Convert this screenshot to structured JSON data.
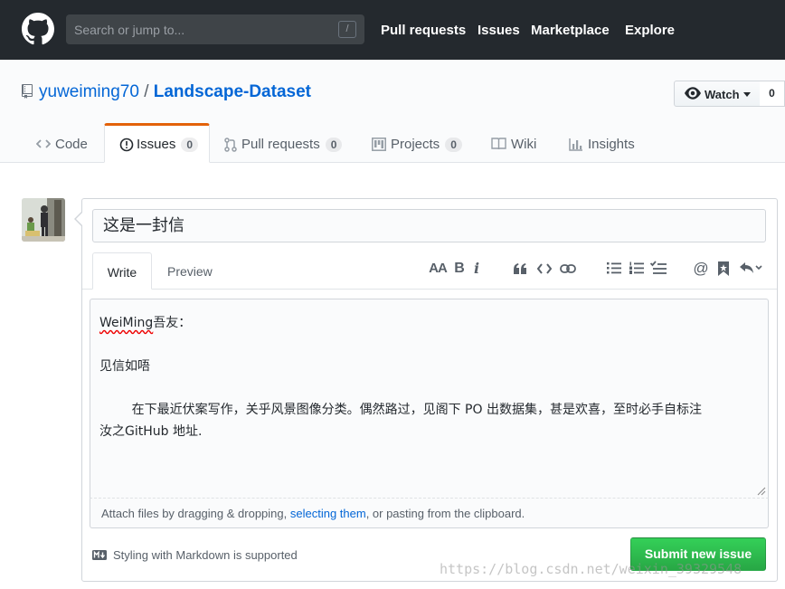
{
  "header": {
    "search_placeholder": "Search or jump to...",
    "search_shortcut": "/",
    "nav": [
      "Pull requests",
      "Issues",
      "Marketplace",
      "Explore"
    ]
  },
  "repo": {
    "owner": "yuweiming70",
    "separator": "/",
    "name": "Landscape-Dataset",
    "watch_label": "Watch",
    "watch_count": "0"
  },
  "tabs": [
    {
      "label": "Code"
    },
    {
      "label": "Issues",
      "count": "0"
    },
    {
      "label": "Pull requests",
      "count": "0"
    },
    {
      "label": "Projects",
      "count": "0"
    },
    {
      "label": "Wiki"
    },
    {
      "label": "Insights"
    }
  ],
  "form": {
    "title_value": "这是一封信",
    "write_tab": "Write",
    "preview_tab": "Preview",
    "body_lines": [
      "WeiMing吾友：",
      "",
      "见信如唔",
      "",
      "        在下最近伏案写作，关乎风景图像分类。偶然路过，见阁下 PO 出数据集，甚是欢喜，至时必手自标注",
      "汝之GitHub 地址."
    ],
    "body_line1_spell": "WeiMing",
    "body_line1_rest": "吾友：",
    "attach_prefix": "Attach files by dragging & dropping, ",
    "attach_link": "selecting them",
    "attach_suffix": ", or pasting from the clipboard.",
    "markdown_note": "Styling with Markdown is supported",
    "submit_label": "Submit new issue"
  },
  "toolbar": {
    "header_text": "AA",
    "bold": "B",
    "italic": "i",
    "mention": "@"
  },
  "watermark": "https://blog.csdn.net/weixin_39329548",
  "colors": {
    "header_bg": "#24292e",
    "link": "#0366d6",
    "selected_tab_accent": "#e36209",
    "submit_green": "#28a745"
  }
}
